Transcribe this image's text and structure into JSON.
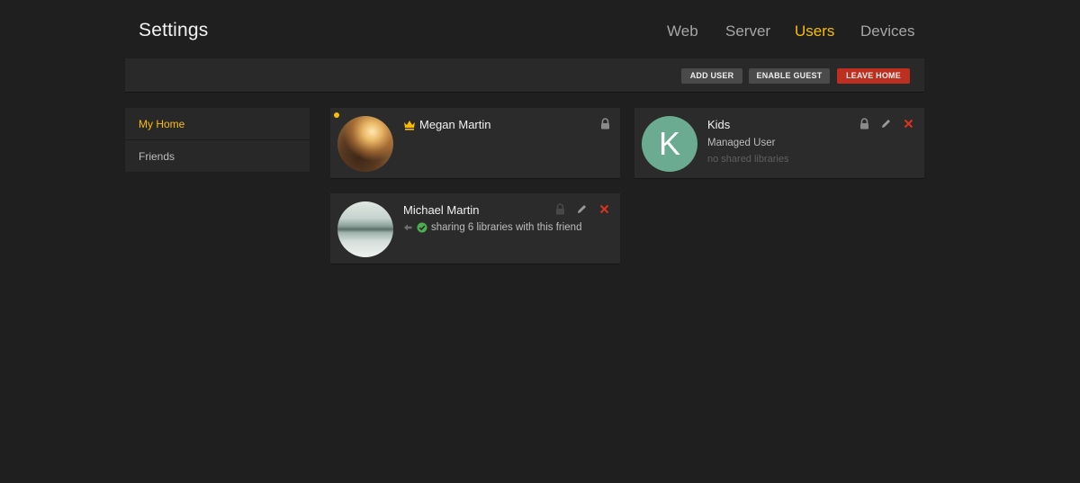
{
  "header": {
    "title": "Settings"
  },
  "nav": {
    "tabs": [
      "Web",
      "Server",
      "Users",
      "Devices"
    ],
    "active": "Users"
  },
  "toolbar": {
    "add_user": "ADD USER",
    "enable_guest": "ENABLE GUEST",
    "leave_home": "LEAVE HOME"
  },
  "sidebar": {
    "items": [
      "My Home",
      "Friends"
    ],
    "active": "My Home"
  },
  "users": [
    {
      "name": "Megan Martin",
      "badge": "crown-icon",
      "online": true,
      "actions": [
        "lock-icon"
      ]
    },
    {
      "name": "Michael Martin",
      "status": "sharing 6 libraries with this friend",
      "actions": [
        "lock-icon",
        "edit-icon",
        "delete-icon"
      ]
    },
    {
      "name": "Kids",
      "initial": "K",
      "role": "Managed User",
      "libraries": "no shared libraries",
      "actions": [
        "lock-icon",
        "edit-icon",
        "delete-icon"
      ]
    }
  ],
  "colors": {
    "accent": "#f9be03",
    "danger": "#bd2f1e",
    "success": "#4caf50",
    "kids_avatar": "#6aab92",
    "background": "#1f1f1f",
    "card": "#2b2b2b"
  }
}
